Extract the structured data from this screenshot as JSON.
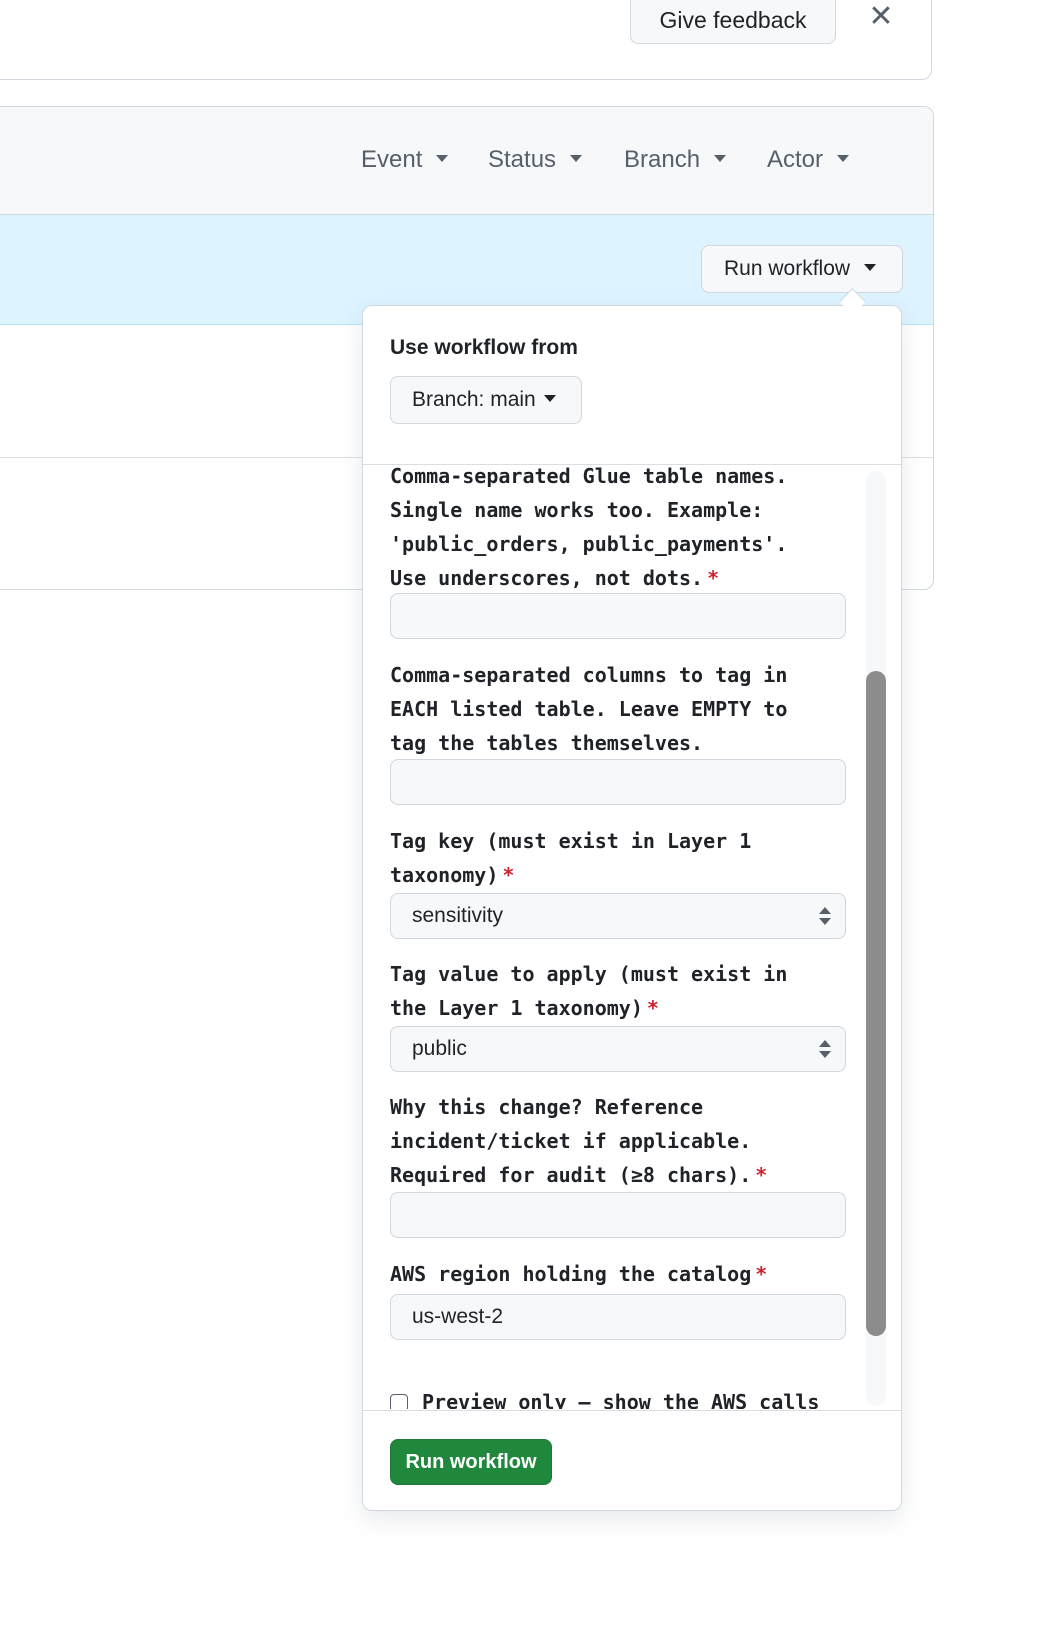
{
  "header": {
    "feedback_label": "Give feedback",
    "close_glyph": "✕"
  },
  "filters": [
    {
      "label": "Event"
    },
    {
      "label": "Status"
    },
    {
      "label": "Branch"
    },
    {
      "label": "Actor"
    }
  ],
  "banner": {
    "run_workflow_label": "Run workflow"
  },
  "popover": {
    "use_from_label": "Use workflow from",
    "branch_label": "Branch: main",
    "fields": [
      {
        "label": "Comma-separated Glue table names. Single name works too. Example: 'public_orders, public_payments'. Use underscores, not dots.",
        "required": true,
        "value": ""
      },
      {
        "label": "Comma-separated columns to tag in EACH listed table. Leave EMPTY to tag the tables themselves.",
        "required": false,
        "value": ""
      },
      {
        "label": "Tag key (must exist in Layer 1 taxonomy)",
        "required": true,
        "value": "sensitivity"
      },
      {
        "label": "Tag value to apply (must exist in the Layer 1 taxonomy)",
        "required": true,
        "value": "public"
      },
      {
        "label": "Why this change? Reference incident/ticket if applicable. Required for audit (≥8 chars).",
        "required": true,
        "value": ""
      },
      {
        "label": "AWS region holding the catalog",
        "required": true,
        "value": "us-west-2"
      }
    ],
    "checkbox_label": "Preview only — show the AWS calls",
    "required_marker": "*",
    "submit_label": "Run workflow"
  },
  "colors": {
    "accent_green": "#1f883d",
    "highlight_blue": "#ddf4ff",
    "required_red": "#cf222e"
  }
}
